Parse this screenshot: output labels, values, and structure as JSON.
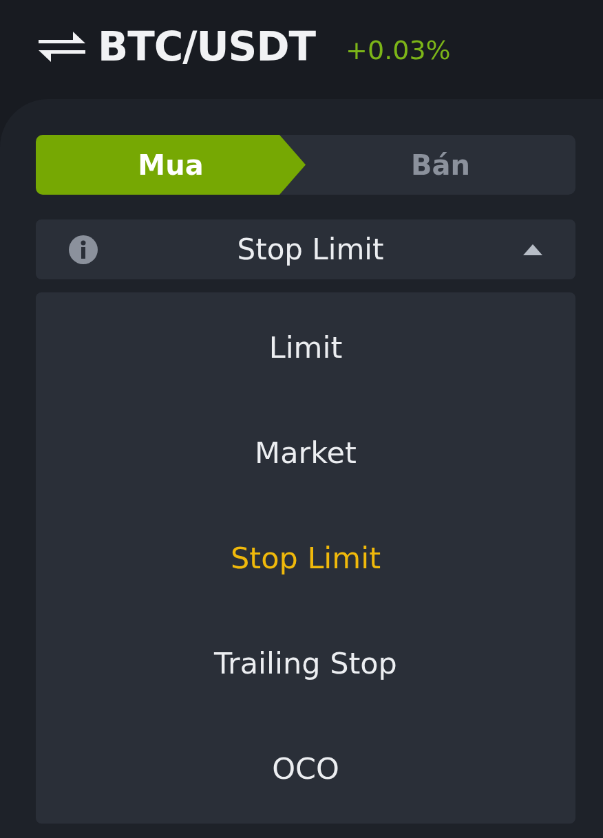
{
  "header": {
    "pair": "BTC/USDT",
    "change": "+0.03%"
  },
  "side_tabs": [
    {
      "label": "Mua",
      "selected": true
    },
    {
      "label": "Bán",
      "selected": false
    }
  ],
  "order_type": {
    "value": "Stop Limit",
    "expanded": true
  },
  "order_type_options": [
    {
      "label": "Limit",
      "selected": false
    },
    {
      "label": "Market",
      "selected": false
    },
    {
      "label": "Stop Limit",
      "selected": true
    },
    {
      "label": "Trailing Stop",
      "selected": false
    },
    {
      "label": "OCO",
      "selected": false
    }
  ]
}
